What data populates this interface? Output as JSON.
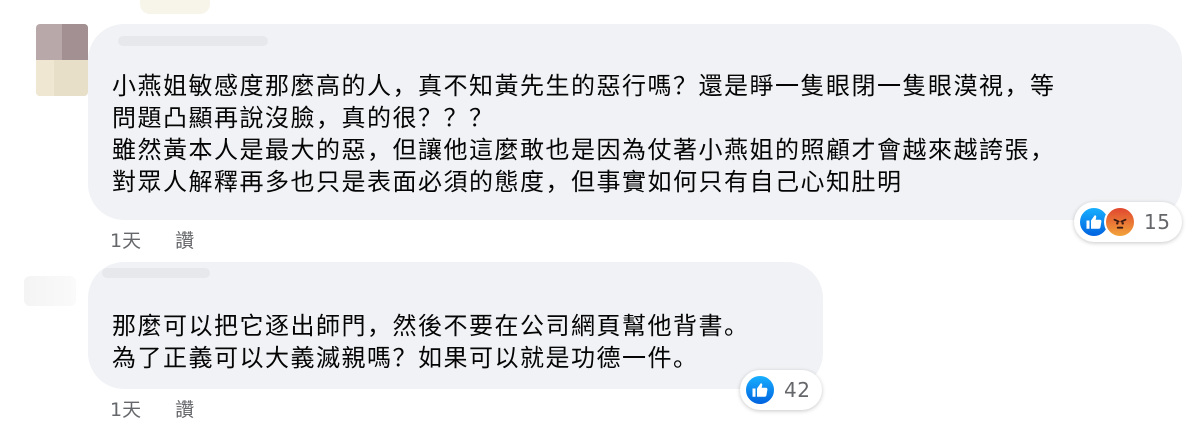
{
  "comments": [
    {
      "text_lines": [
        "小燕姐敏感度那麼高的人，真不知黃先生的惡行嗎？還是睜一隻眼閉一隻眼漠視，等",
        "問題凸顯再說沒臉，真的很？？？",
        "雖然黃本人是最大的惡，但讓他這麼敢也是因為仗著小燕姐的照顧才會越來越誇張，",
        "對眾人解釋再多也只是表面必須的態度，但事實如何只有自己心知肚明"
      ],
      "reactions": {
        "icons": [
          "like-icon",
          "angry-icon"
        ],
        "count": "15"
      },
      "time": "1天",
      "reply_label": "讚"
    },
    {
      "text_lines": [
        "那麼可以把它逐出師門，然後不要在公司網頁幫他背書。",
        "為了正義可以大義滅親嗎？如果可以就是功德一件。"
      ],
      "reactions": {
        "icons": [
          "like-icon"
        ],
        "count": "42"
      },
      "time": "1天",
      "reply_label": "讚"
    }
  ],
  "colors": {
    "bubble": "#f0f2f5",
    "text": "#050505",
    "meta": "#65676b",
    "like": "#1877f2",
    "angry": "#e9710f"
  }
}
